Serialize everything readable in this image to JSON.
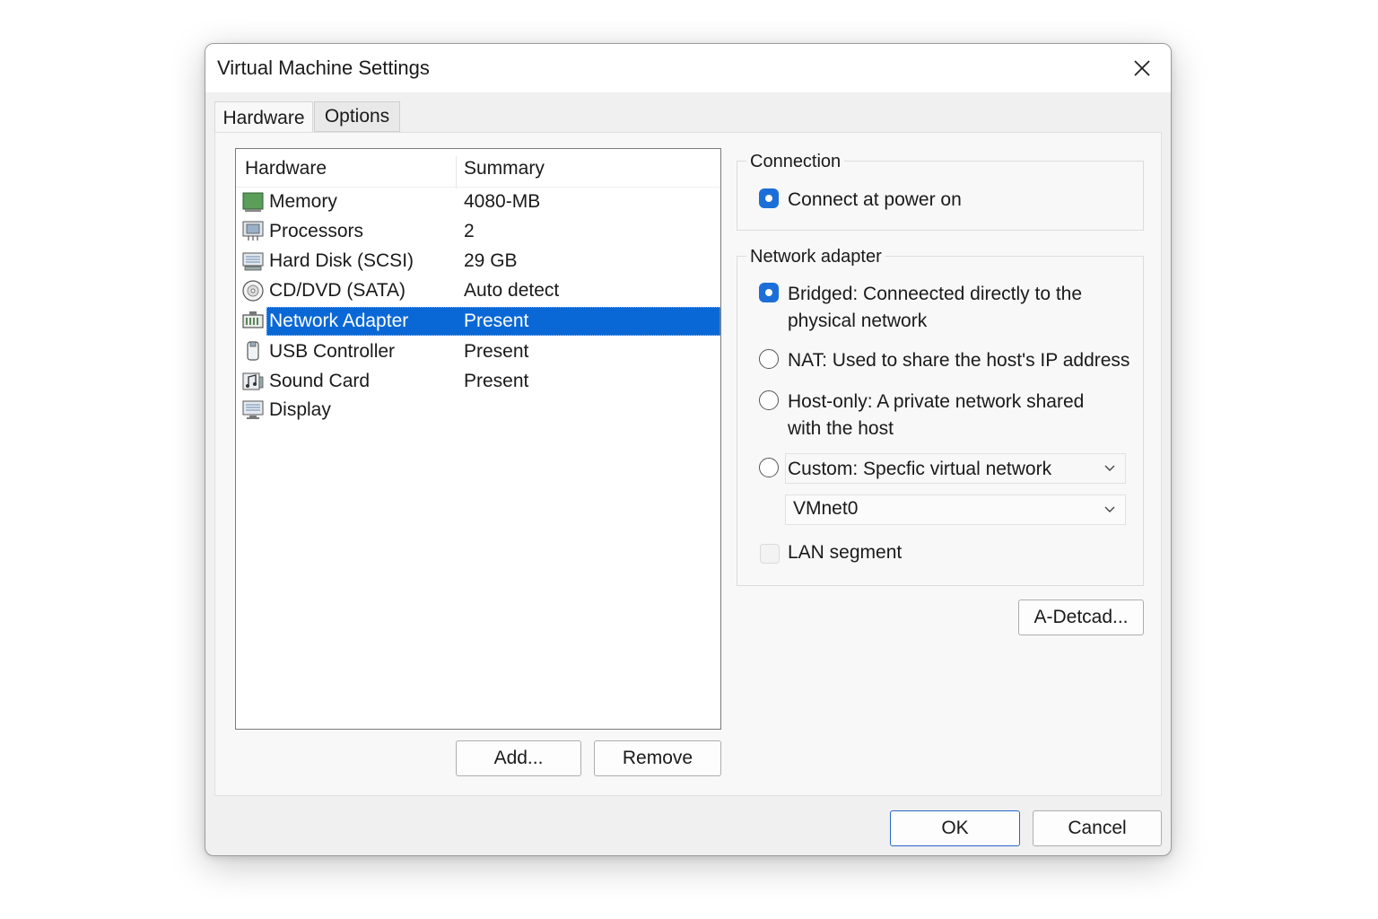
{
  "window": {
    "title": "Virtual Machine Settings"
  },
  "tabs": [
    {
      "label": "Hardware",
      "active": true
    },
    {
      "label": "Options",
      "active": false
    }
  ],
  "hardware_list": {
    "columns": [
      "Hardware",
      "Summary"
    ],
    "rows": [
      {
        "name": "Memory",
        "summary": "4080-MB",
        "icon": "memory-icon"
      },
      {
        "name": "Processors",
        "summary": "2",
        "icon": "processor-icon"
      },
      {
        "name": "Hard Disk (SCSI)",
        "summary": "29 GB",
        "icon": "hard-disk-icon"
      },
      {
        "name": "CD/DVD (SATA)",
        "summary": "Auto detect",
        "icon": "cd-dvd-icon"
      },
      {
        "name": "Network Adapter",
        "summary": "Present",
        "icon": "network-adapter-icon",
        "selected": true
      },
      {
        "name": "USB Controller",
        "summary": "Present",
        "icon": "usb-controller-icon"
      },
      {
        "name": "Sound Card",
        "summary": "Present",
        "icon": "sound-card-icon"
      },
      {
        "name": "Display",
        "summary": "",
        "icon": "display-icon"
      }
    ]
  },
  "list_buttons": {
    "add": "Add...",
    "remove": "Remove"
  },
  "connection": {
    "legend": "Connection",
    "connect_at_power_on": {
      "label": "Connect at power on",
      "checked": true
    }
  },
  "network_adapter": {
    "legend": "Network adapter",
    "options": [
      {
        "line1": "Bridged: Conneected directly to the",
        "line2": "physical network",
        "checked": true
      },
      {
        "line1": "NAT: Used to share the host's IP address",
        "line2": "",
        "checked": false
      },
      {
        "line1": "Host-only: A private network shared",
        "line2": "with the host",
        "checked": false
      },
      {
        "line1": "Custom: Specfic virtual network",
        "line2": "",
        "checked": false
      }
    ],
    "vmnet_value": "VMnet0",
    "lan_segment": {
      "label": "LAN segment",
      "checked": false
    }
  },
  "advanced_button": "A-Detcad...",
  "footer": {
    "ok": "OK",
    "cancel": "Cancel"
  },
  "colors": {
    "accent": "#0a68d6",
    "radio_checked": "#1c6fd8"
  }
}
